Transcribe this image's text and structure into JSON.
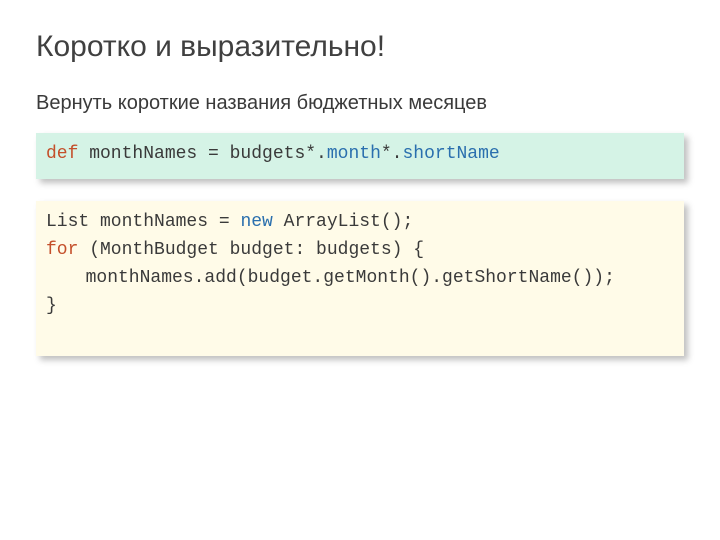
{
  "title": "Коротко и выразительно!",
  "subtitle": "Вернуть короткие названия бюджетных месяцев",
  "groovy": {
    "kw_def": "def",
    "var": " monthNames = budgets*.",
    "attr1": "month",
    "star": "*.",
    "attr2": "shortName"
  },
  "java": {
    "line1_a": "List monthNames = ",
    "line1_new": "new",
    "line1_b": " ArrayList();",
    "line2_for": "for",
    "line2_rest": " (MonthBudget budget: budgets) {",
    "line3": "monthNames.add(budget.getMonth().getShortName());",
    "line4": "}"
  }
}
